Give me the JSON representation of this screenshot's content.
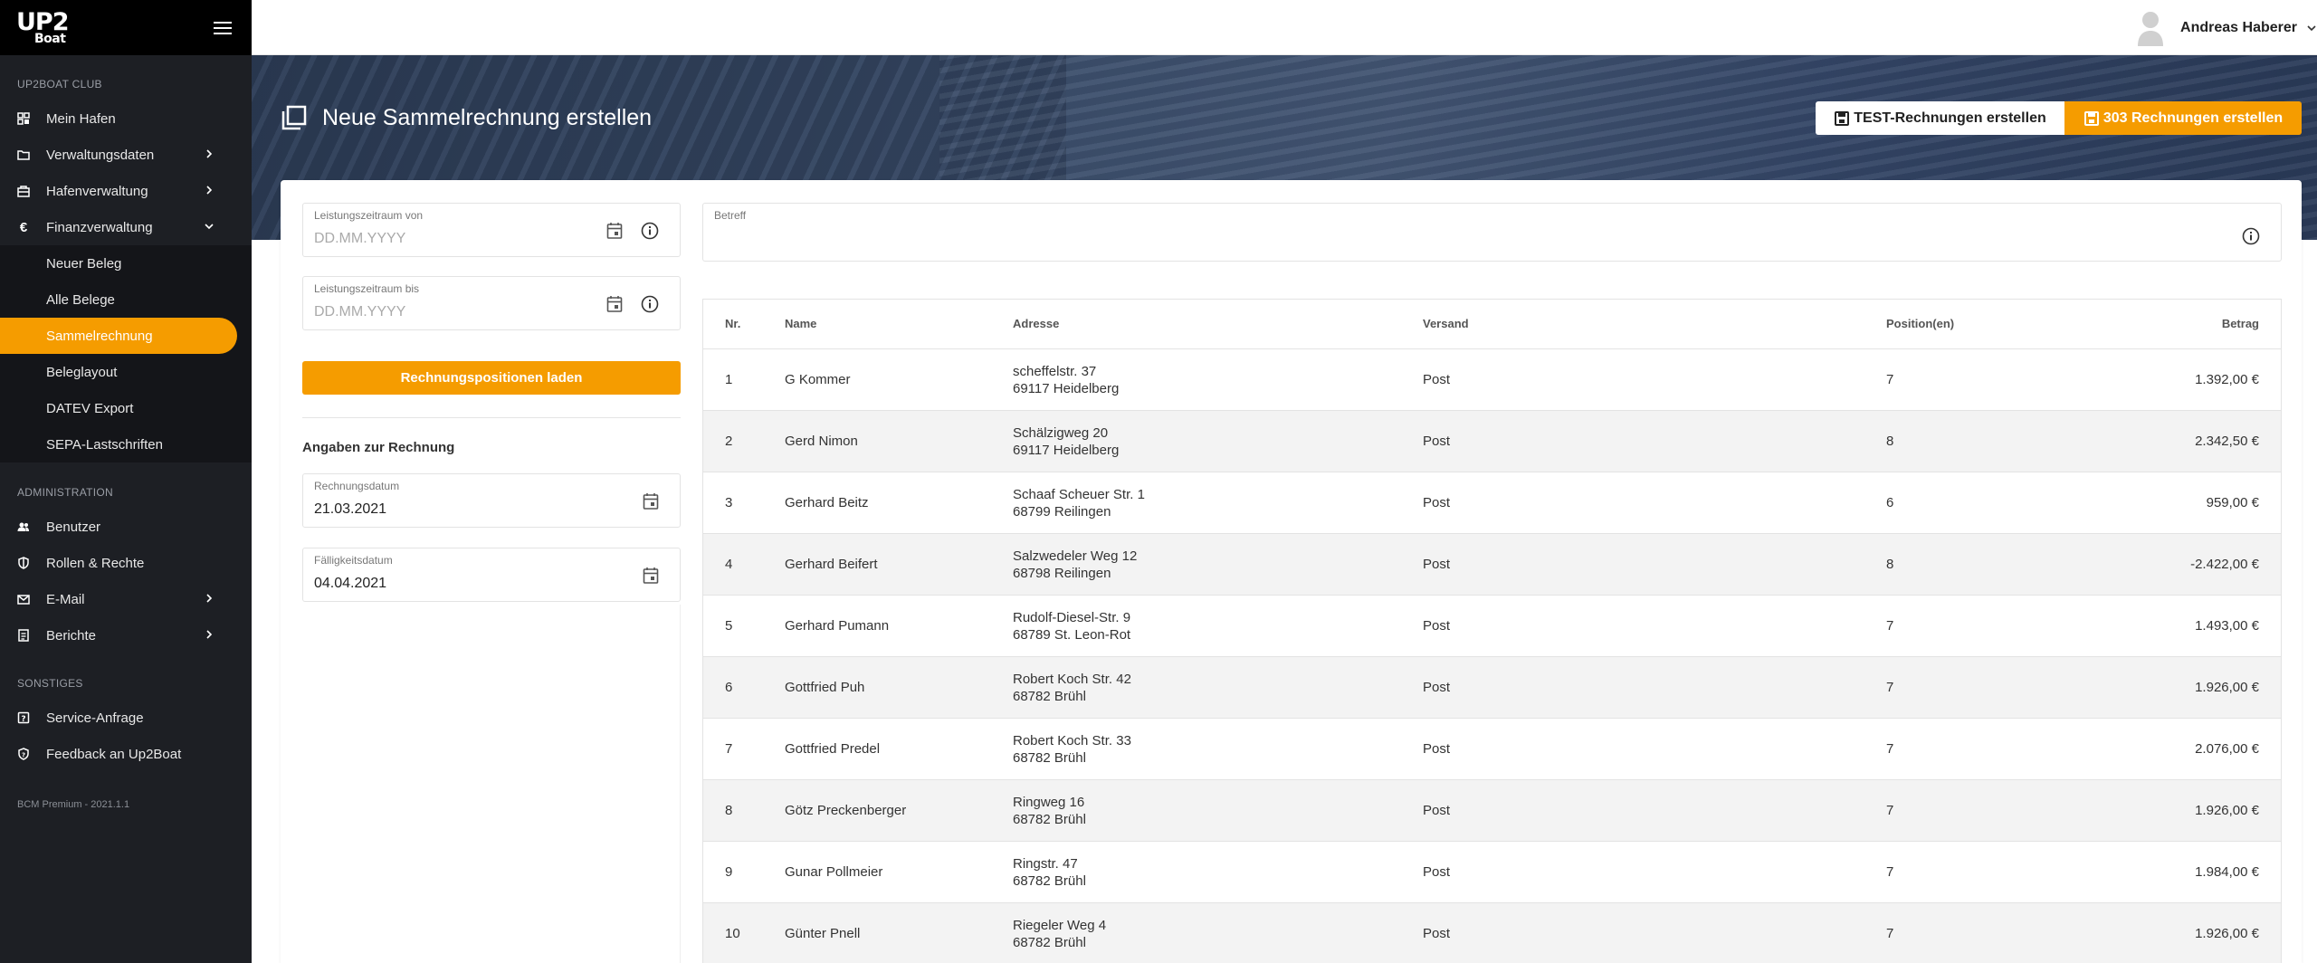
{
  "sidebar": {
    "logo_line1": "UP2",
    "logo_line2": "Boat",
    "section_club": "UP2BOAT CLUB",
    "items_club": [
      {
        "label": "Mein Hafen",
        "icon": "dashboard-icon",
        "chevron": ""
      },
      {
        "label": "Verwaltungsdaten",
        "icon": "folder-icon",
        "chevron": "right"
      },
      {
        "label": "Hafenverwaltung",
        "icon": "harbor-icon",
        "chevron": "right"
      },
      {
        "label": "Finanzverwaltung",
        "icon": "euro-icon",
        "chevron": "down"
      }
    ],
    "sub_items": [
      "Neuer Beleg",
      "Alle Belege",
      "Sammelrechnung",
      "Beleglayout",
      "DATEV Export",
      "SEPA-Lastschriften"
    ],
    "active_sub": "Sammelrechnung",
    "section_admin": "ADMINISTRATION",
    "items_admin": [
      {
        "label": "Benutzer",
        "icon": "users-icon"
      },
      {
        "label": "Rollen & Rechte",
        "icon": "shield-icon"
      },
      {
        "label": "E-Mail",
        "icon": "mail-icon"
      },
      {
        "label": "Berichte",
        "icon": "report-icon"
      }
    ],
    "section_misc": "SONSTIGES",
    "items_misc": [
      {
        "label": "Service-Anfrage",
        "icon": "service-icon"
      },
      {
        "label": "Feedback an Up2Boat",
        "icon": "feedback-icon"
      }
    ],
    "version": "BCM Premium - 2021.1.1"
  },
  "topbar": {
    "user_name": "Andreas Haberer"
  },
  "header": {
    "title": "Neue Sammelrechnung erstellen",
    "btn_test": "TEST-Rechnungen erstellen",
    "btn_main": "303 Rechnungen erstellen"
  },
  "form": {
    "from_label": "Leistungszeitraum von",
    "from_placeholder": "DD.MM.YYYY",
    "to_label": "Leistungszeitraum bis",
    "to_placeholder": "DD.MM.YYYY",
    "load_button": "Rechnungspositionen laden",
    "section_title": "Angaben zur Rechnung",
    "invoice_date_label": "Rechnungsdatum",
    "invoice_date_value": "21.03.2021",
    "due_date_label": "Fälligkeitsdatum",
    "due_date_value": "04.04.2021",
    "subject_label": "Betreff",
    "subject_value": ""
  },
  "table": {
    "headers": {
      "nr": "Nr.",
      "name": "Name",
      "address": "Adresse",
      "shipping": "Versand",
      "positions": "Position(en)",
      "amount": "Betrag"
    },
    "rows": [
      {
        "nr": "1",
        "name": "G Kommer",
        "street": "scheffelstr. 37",
        "city": "69117 Heidelberg",
        "shipping": "Post",
        "positions": "7",
        "amount": "1.392,00 €"
      },
      {
        "nr": "2",
        "name": "Gerd Nimon",
        "street": "Schälzigweg 20",
        "city": "69117 Heidelberg",
        "shipping": "Post",
        "positions": "8",
        "amount": "2.342,50 €"
      },
      {
        "nr": "3",
        "name": "Gerhard Beitz",
        "street": "Schaaf Scheuer Str. 1",
        "city": "68799 Reilingen",
        "shipping": "Post",
        "positions": "6",
        "amount": "959,00 €"
      },
      {
        "nr": "4",
        "name": "Gerhard Beifert",
        "street": "Salzwedeler Weg 12",
        "city": "68798 Reilingen",
        "shipping": "Post",
        "positions": "8",
        "amount": "-2.422,00 €"
      },
      {
        "nr": "5",
        "name": "Gerhard Pumann",
        "street": "Rudolf-Diesel-Str. 9",
        "city": "68789 St. Leon-Rot",
        "shipping": "Post",
        "positions": "7",
        "amount": "1.493,00 €"
      },
      {
        "nr": "6",
        "name": "Gottfried Puh",
        "street": "Robert Koch Str. 42",
        "city": "68782 Brühl",
        "shipping": "Post",
        "positions": "7",
        "amount": "1.926,00 €"
      },
      {
        "nr": "7",
        "name": "Gottfried Predel",
        "street": "Robert Koch Str. 33",
        "city": "68782 Brühl",
        "shipping": "Post",
        "positions": "7",
        "amount": "2.076,00 €"
      },
      {
        "nr": "8",
        "name": "Götz Preckenberger",
        "street": "Ringweg 16",
        "city": "68782 Brühl",
        "shipping": "Post",
        "positions": "7",
        "amount": "1.926,00 €"
      },
      {
        "nr": "9",
        "name": "Gunar Pollmeier",
        "street": "Ringstr. 47",
        "city": "68782 Brühl",
        "shipping": "Post",
        "positions": "7",
        "amount": "1.984,00 €"
      },
      {
        "nr": "10",
        "name": "Günter Pnell",
        "street": "Riegeler Weg 4",
        "city": "68782 Brühl",
        "shipping": "Post",
        "positions": "7",
        "amount": "1.926,00 €"
      }
    ]
  },
  "colors": {
    "accent": "#f59c00",
    "sidebar_bg": "#1d1f24",
    "logo_bg": "#000000"
  }
}
